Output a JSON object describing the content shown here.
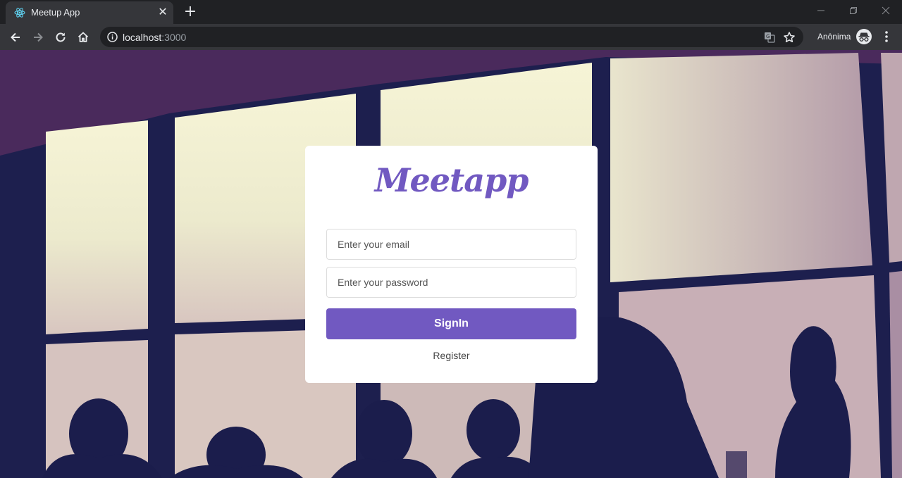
{
  "browser": {
    "tab_title": "Meetup App",
    "tab_close": "✕",
    "new_tab": "+",
    "url_host": "localhost",
    "url_port": ":3000",
    "profile_label": "Anônima"
  },
  "login": {
    "logo_text": "Meetapp",
    "email_placeholder": "Enter your email",
    "password_placeholder": "Enter your password",
    "signin_label": "SignIn",
    "register_label": "Register"
  },
  "colors": {
    "brand": "#7159c1",
    "tab_active": "#35363a",
    "frame": "#202124"
  },
  "icons": {
    "favicon": "react-atom-icon",
    "back": "arrow-left-icon",
    "forward": "arrow-right-icon",
    "reload": "reload-icon",
    "home": "home-icon",
    "site_info": "info-icon",
    "translate": "translate-icon",
    "bookmark": "star-icon",
    "incognito": "incognito-icon",
    "menu": "kebab-menu-icon"
  }
}
